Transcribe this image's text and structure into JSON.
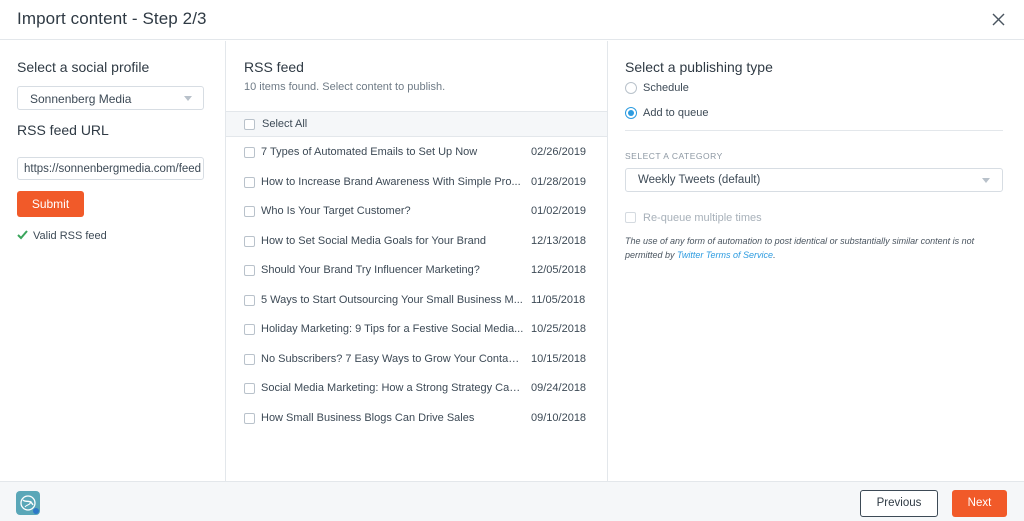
{
  "header": {
    "title": "Import content - Step 2/3",
    "close_icon": "close-icon"
  },
  "left": {
    "profile_heading": "Select a social profile",
    "profile_selected": "Sonnenberg Media",
    "url_heading": "RSS feed URL",
    "url_value": "https://sonnenbergmedia.com/feed",
    "submit_label": "Submit",
    "valid_text": "Valid RSS feed",
    "valid_icon": "check-icon",
    "valid_color": "#3aa55c"
  },
  "middle": {
    "heading": "RSS feed",
    "subtitle": "10 items found. Select content to publish.",
    "select_all_label": "Select All",
    "items": [
      {
        "title": "7 Types of Automated Emails to Set Up Now",
        "date": "02/26/2019"
      },
      {
        "title": "How to Increase Brand Awareness With Simple Pro...",
        "date": "01/28/2019"
      },
      {
        "title": "Who Is Your Target Customer?",
        "date": "01/02/2019"
      },
      {
        "title": "How to Set Social Media Goals for Your Brand",
        "date": "12/13/2018"
      },
      {
        "title": "Should Your Brand Try Influencer Marketing?",
        "date": "12/05/2018"
      },
      {
        "title": "5 Ways to Start Outsourcing Your Small Business M...",
        "date": "11/05/2018"
      },
      {
        "title": "Holiday Marketing: 9 Tips for a Festive Social Media...",
        "date": "10/25/2018"
      },
      {
        "title": "No Subscribers? 7 Easy Ways to Grow Your Contact ...",
        "date": "10/15/2018"
      },
      {
        "title": "Social Media Marketing: How a Strong Strategy Can...",
        "date": "09/24/2018"
      },
      {
        "title": "How Small Business Blogs Can Drive Sales",
        "date": "09/10/2018"
      }
    ]
  },
  "right": {
    "heading": "Select a publishing type",
    "option_schedule": "Schedule",
    "option_queue": "Add to queue",
    "selected_option": "Add to queue",
    "category_label": "SELECT A CATEGORY",
    "category_selected": "Weekly Tweets  (default)",
    "requeue_label": "Re-queue multiple times",
    "disclaimer_text": "The use of any form of automation to post identical or substantially similar content is not permitted by ",
    "disclaimer_link": "Twitter Terms of Service",
    "disclaimer_end": "."
  },
  "footer": {
    "logo_icon": "app-logo-icon",
    "previous_label": "Previous",
    "next_label": "Next"
  },
  "colors": {
    "accent": "#f15a29",
    "link": "#2c9be0",
    "border": "#e3e7eb",
    "footer_bg": "#f5f7f9"
  }
}
